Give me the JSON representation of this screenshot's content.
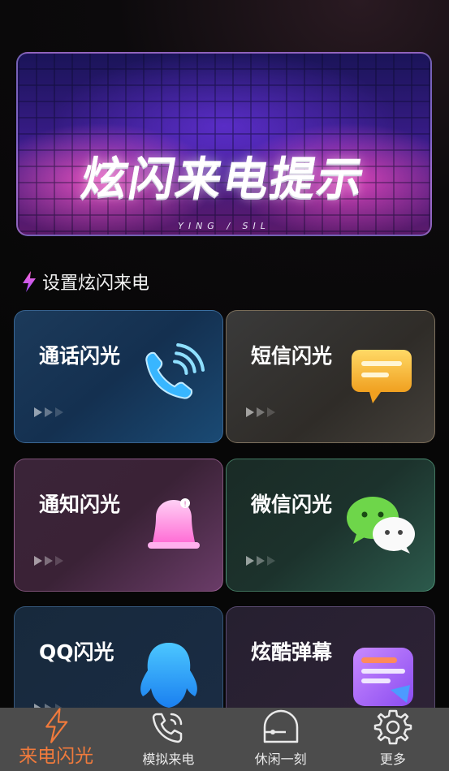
{
  "banner": {
    "title": "炫闪来电提示",
    "subtitle": "YING / SIL"
  },
  "section": {
    "title": "设置炫闪来电",
    "icon": "lightning-icon"
  },
  "cards": [
    {
      "label": "通话闪光",
      "icon": "phone-call-icon"
    },
    {
      "label": "短信闪光",
      "icon": "message-bubble-icon"
    },
    {
      "label": "通知闪光",
      "icon": "bell-icon"
    },
    {
      "label": "微信闪光",
      "icon": "wechat-icon"
    },
    {
      "label": "QQ闪光",
      "icon": "qq-penguin-icon"
    },
    {
      "label": "炫酷弹幕",
      "icon": "danmaku-icon"
    }
  ],
  "nav": {
    "items": [
      {
        "label": "来电闪光",
        "icon": "lightning-icon",
        "active": true
      },
      {
        "label": "模拟来电",
        "icon": "phone-icon",
        "active": false
      },
      {
        "label": "休闲一刻",
        "icon": "leisure-icon",
        "active": false
      },
      {
        "label": "更多",
        "icon": "gear-icon",
        "active": false
      }
    ]
  },
  "colors": {
    "accent": "#f07a3c",
    "nav_bg": "#4c4c4c"
  }
}
